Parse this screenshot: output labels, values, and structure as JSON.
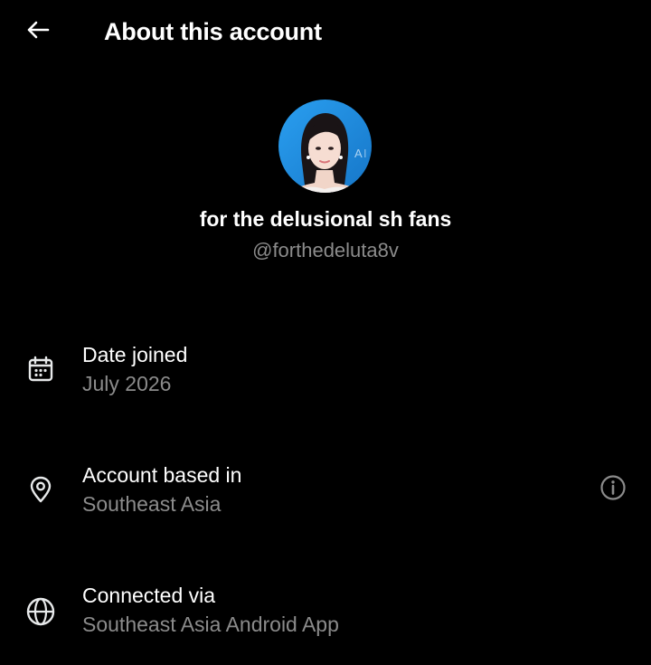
{
  "header": {
    "title": "About this account",
    "back_icon": "arrow-left-icon"
  },
  "profile": {
    "display_name": "for the delusional sh fans",
    "handle": "@forthedeluta8v",
    "avatar_accent": "#1f8fe0"
  },
  "rows": [
    {
      "icon": "calendar-icon",
      "label": "Date joined",
      "value": "July 2026"
    },
    {
      "icon": "location-pin-icon",
      "label": "Account based in",
      "value": "Southeast Asia",
      "trailing_icon": "info-icon"
    },
    {
      "icon": "globe-icon",
      "label": "Connected via",
      "value": "Southeast Asia Android App"
    }
  ],
  "colors": {
    "background": "#000000",
    "primary_text": "#ffffff",
    "secondary_text": "#8b8b8b",
    "icon": "#e7e9ea"
  }
}
